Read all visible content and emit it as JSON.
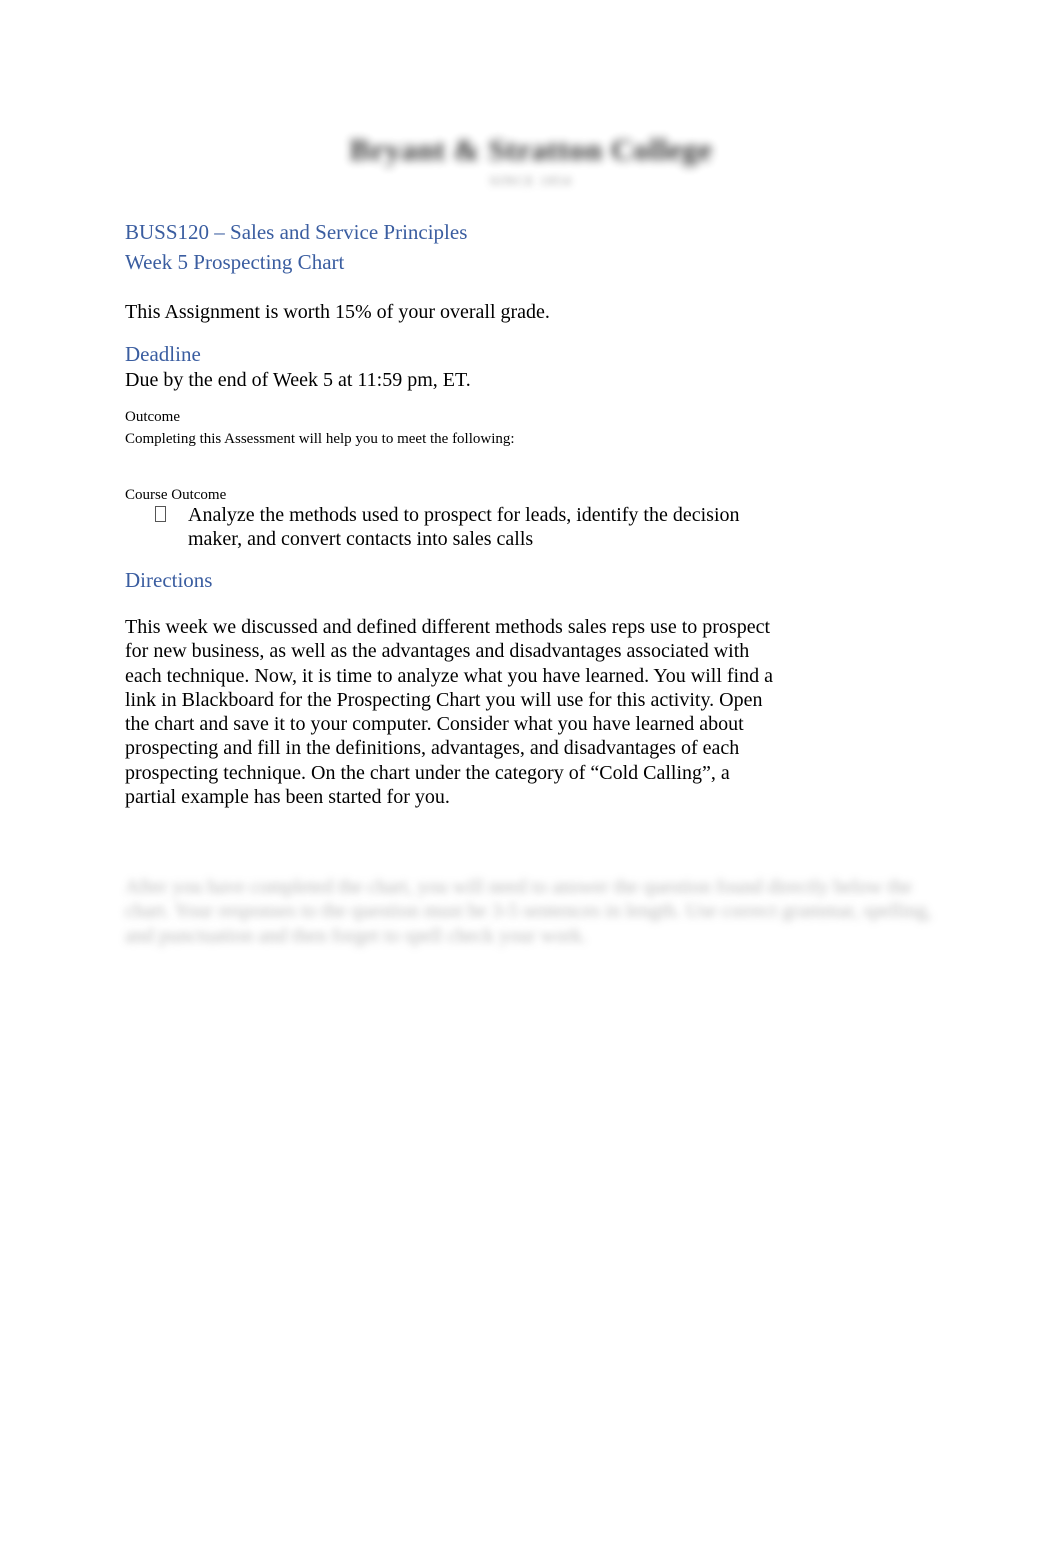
{
  "document": {
    "background_color": "#ffffff",
    "heading_color": "#3a5da0",
    "body_color": "#000000"
  },
  "masthead": {
    "institution": "Bryant & Stratton College",
    "tagline": "SINCE 1854"
  },
  "headings": {
    "course": "BUSS120 – Sales and Service Principles",
    "assignment": "Week 5 Prospecting Chart",
    "deadline": "Deadline",
    "directions": "Directions"
  },
  "weight_statement": "This Assignment is worth 15% of your overall grade.",
  "deadline": {
    "text": "Due by the end of Week 5 at 11:59 pm, ET."
  },
  "outcome": {
    "label": "Outcome",
    "intro": "Completing this Assessment will help you to meet the following:",
    "course_outcome_label": "Course Outcome",
    "bullet_glyph": "tofu-box-bullet",
    "items": [
      "Analyze the methods used to prospect for leads, identify the decision maker, and convert contacts into sales calls"
    ]
  },
  "directions": {
    "paragraph": "This week we discussed and defined different methods sales reps use to prospect for new business, as well as the advantages and disadvantages associated with each technique. Now, it is time to analyze what you have learned. You will find a link in Blackboard for the Prospecting Chart you will use for this activity. Open the chart and save it to your computer. Consider what you have learned about prospecting and fill in the definitions, advantages, and disadvantages of each prospecting technique. On the chart under the category of “Cold Calling”, a partial example has been started for you."
  },
  "redacted_paragraph": {
    "status": "blurred-illegible",
    "approximate_text": "After you have completed the chart, you will need to answer the question found directly below the chart. Your responses to the question must be 3-5 sentences in length. Use correct grammar, spelling, and punctuation and then forget to spell check your work."
  }
}
